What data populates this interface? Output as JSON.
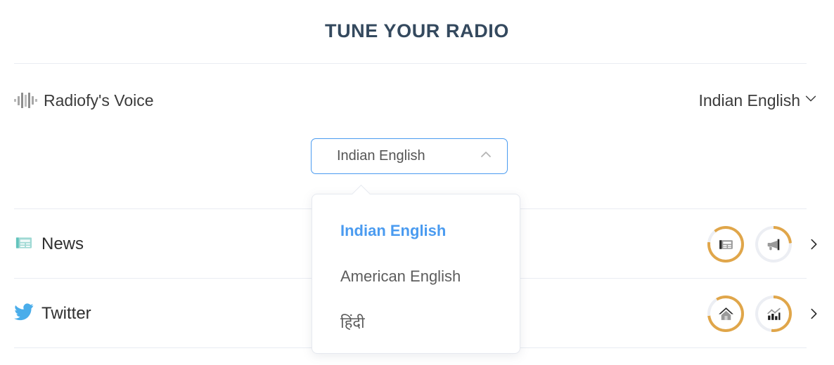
{
  "header": {
    "title": "TUNE YOUR RADIO"
  },
  "voice": {
    "icon": "waveform-icon",
    "label": "Radiofy's Voice",
    "language_value": "Indian English",
    "chevron": "chevron-down-icon"
  },
  "language_select": {
    "value": "Indian English",
    "caret": "chevron-up-icon",
    "expanded": true,
    "options": [
      {
        "label": "Indian English",
        "selected": true
      },
      {
        "label": "American English",
        "selected": false
      },
      {
        "label": "हिंदी",
        "selected": false
      }
    ]
  },
  "sources": [
    {
      "label": "News",
      "icon": "newspaper-icon",
      "icon_color": "#63c4bd",
      "actions": [
        {
          "name": "newspaper-progress-icon",
          "progress": 88,
          "icon": "newspaper-icon"
        },
        {
          "name": "megaphone-progress-icon",
          "progress": 24,
          "icon": "megaphone-icon"
        }
      ],
      "chevron": "chevron-right-icon"
    },
    {
      "label": "Twitter",
      "icon": "twitter-bird-icon",
      "icon_color": "#4aadea",
      "actions": [
        {
          "name": "home-progress-icon",
          "progress": 82,
          "icon": "home-icon"
        },
        {
          "name": "analytics-progress-icon",
          "progress": 52,
          "icon": "bar-chart-icon"
        }
      ],
      "chevron": "chevron-right-icon"
    }
  ],
  "colors": {
    "accent_blue": "#4a9bf0",
    "progress_orange": "#e0a64a",
    "progress_track": "#eceef3",
    "title": "#34495e",
    "divider": "#e9ecf2"
  }
}
